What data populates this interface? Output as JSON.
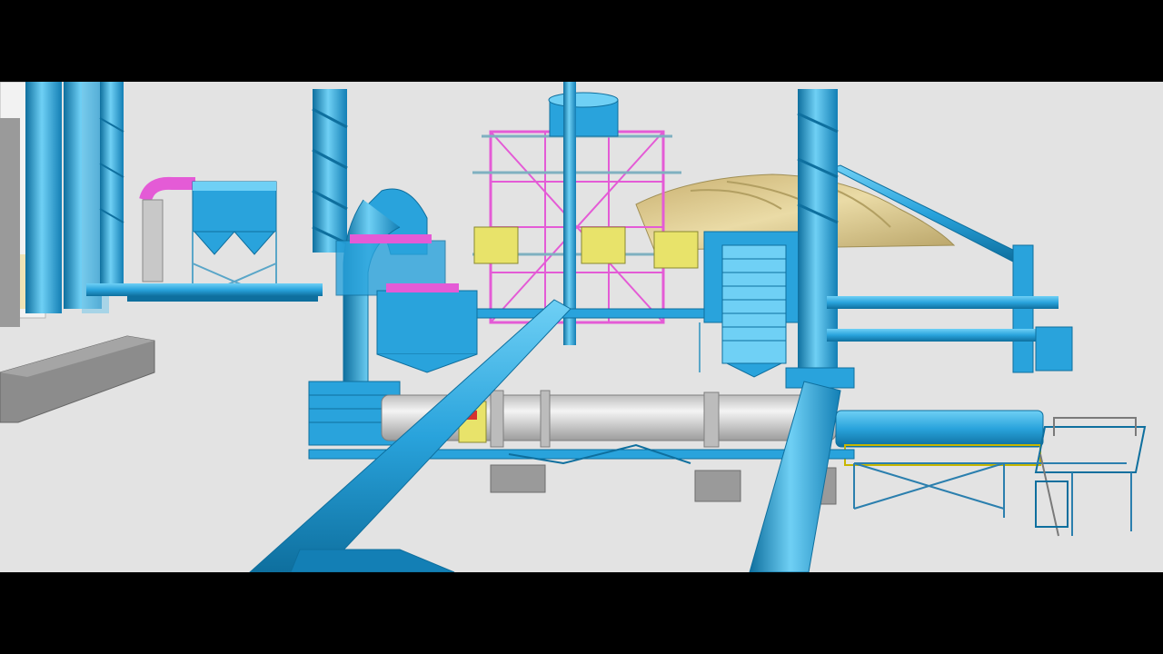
{
  "viewer": {
    "letterbox_color": "#000000",
    "background_color": "#e3e3e3"
  },
  "palette": {
    "pipe_blue": "#29a3dc",
    "pipe_light": "#6fd0f5",
    "pipe_dark": "#0e6f9e",
    "steel_magenta": "#e45bd6",
    "equipment_yellow": "#e8e36a",
    "drum_silver": "#d5d5d5",
    "stockpile_tan": "#d8c48a",
    "concrete_gray": "#8c8c8c"
  },
  "scene": {
    "subject": "industrial-plant-3d-model",
    "components": [
      "rotary-dryer-drum",
      "baghouse-filter-left",
      "baghouse-filter-center",
      "cyclone-separator",
      "exhaust-stack-left",
      "exhaust-stack-center",
      "exhaust-stack-right",
      "steel-tower-structure",
      "stockpile",
      "conveyor-belt",
      "pipe-rack",
      "walkway-platform",
      "concrete-blocks"
    ]
  }
}
